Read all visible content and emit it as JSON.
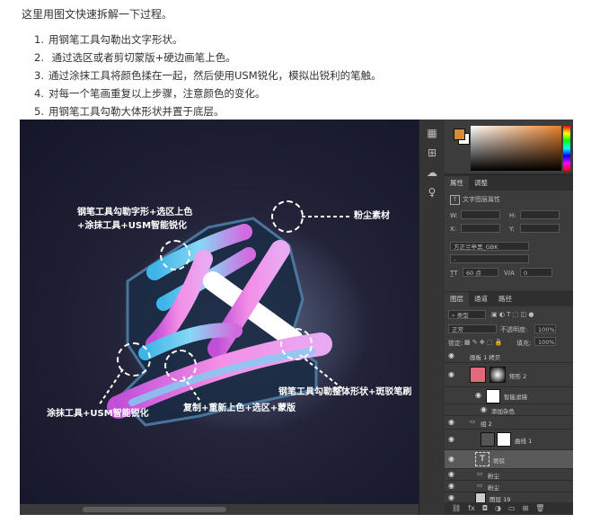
{
  "intro": "这里用图文快速拆解一下过程。",
  "steps": [
    {
      "num": "1.",
      "text": "用钢笔工具勾勒出文字形状。"
    },
    {
      "num": "2.",
      "text": " 通过选区或者剪切蒙版+硬边画笔上色。"
    },
    {
      "num": "3.",
      "text": "通过涂抹工具将颜色揉在一起，然后使用USM锐化，模拟出锐利的笔触。"
    },
    {
      "num": "4.",
      "text": "对每一个笔画重复以上步骤，注意颜色的变化。"
    },
    {
      "num": "5.",
      "text": "用钢笔工具勾勒大体形状并置于底层。"
    }
  ],
  "annotations": {
    "top_left_line1": "钢笔工具勾勒字形+选区上色",
    "top_left_line2": "+涂抹工具+USM智能锐化",
    "dust": "粉尘素材",
    "outline": "钢笔工具勾勒整体形状+斑驳笔刷",
    "bottom_left": "涂抹工具+USM智能锐化",
    "copy": "复制+重新上色+选区+蒙版"
  },
  "colors": {
    "foreground": "#d88a3a",
    "background": "#ffffff"
  },
  "properties": {
    "tab_active": "属性",
    "tab_other": "调整",
    "layer_type": "文字图层属性",
    "w_label": "W:",
    "h_label": "H:",
    "x_label": "X:",
    "y_label": "Y:",
    "font_name": "方正兰亭黑_GBK",
    "font_size": "60 点",
    "tracking": "0",
    "dash": "-"
  },
  "layers_panel": {
    "tabs": [
      "图层",
      "通道",
      "路径"
    ],
    "filter": "类型",
    "blend_mode": "正常",
    "opacity_label": "不透明度:",
    "opacity": "100%",
    "lock_label": "锁定:",
    "fill_label": "填充:",
    "fill": "100%",
    "layers": [
      {
        "name": "画板 1 拷贝"
      },
      {
        "name": "矩形 2"
      },
      {
        "name": "智能滤镜"
      },
      {
        "name": "添加杂色"
      },
      {
        "name": "组 2"
      },
      {
        "name": "曲线 1"
      },
      {
        "name": "斑驳"
      },
      {
        "name": "粉尘"
      },
      {
        "name": "粉尘"
      },
      {
        "name": "图层 19"
      }
    ],
    "bottom_icons": [
      "link-icon",
      "fx-icon",
      "mask-icon",
      "adjustment-icon",
      "folder-icon",
      "new-layer-icon",
      "trash-icon"
    ]
  }
}
